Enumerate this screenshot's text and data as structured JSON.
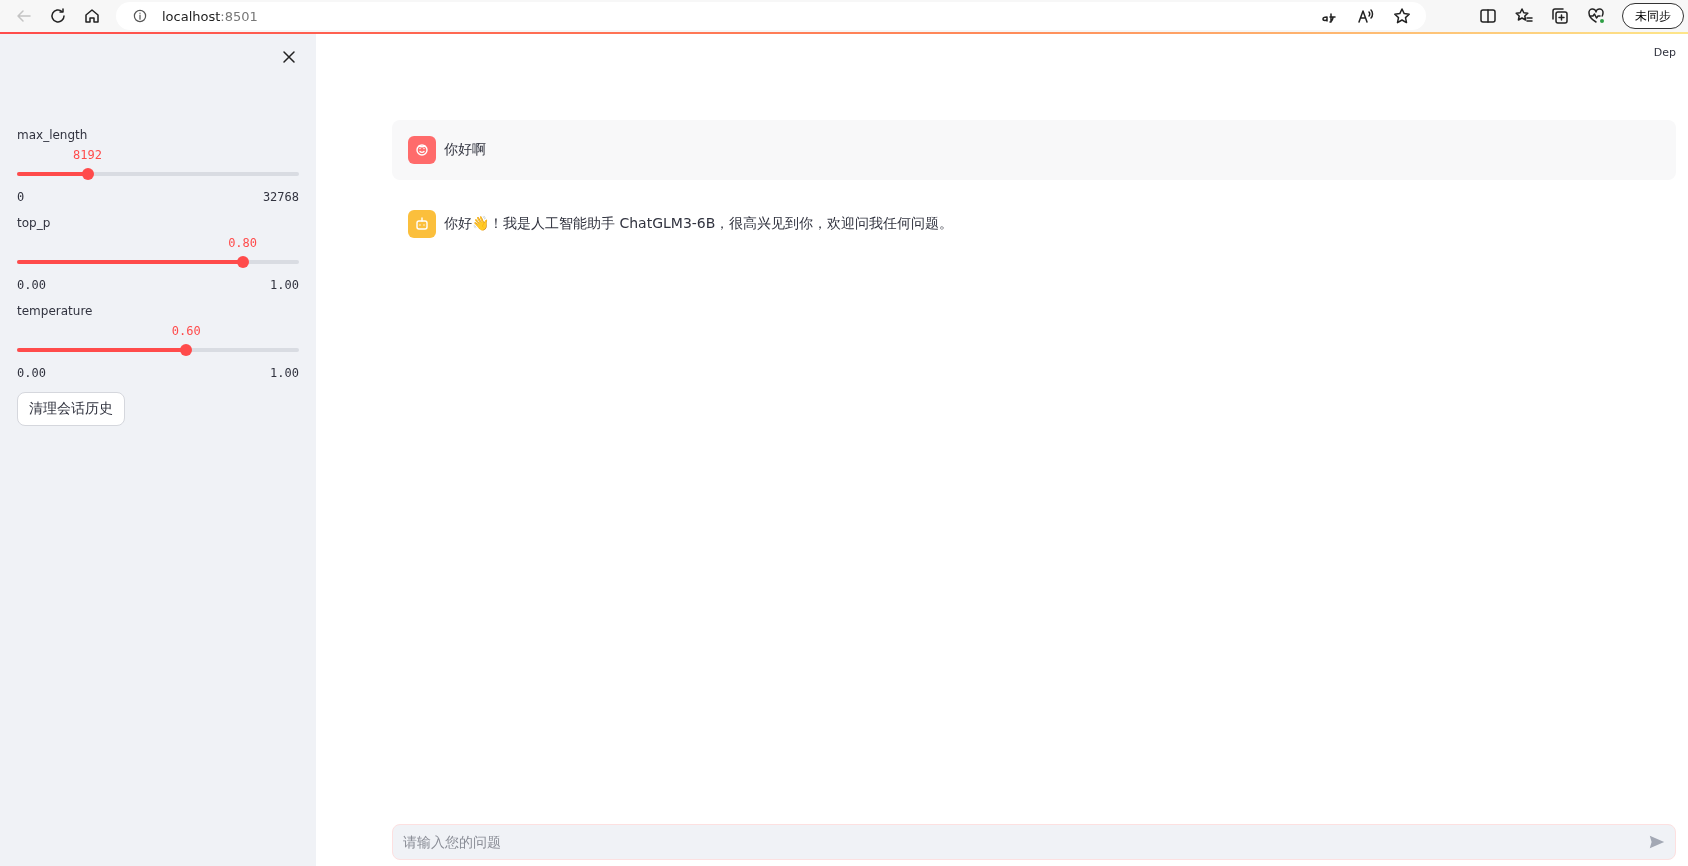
{
  "browser": {
    "back_disabled": true,
    "address_host": "localhost",
    "address_port": ":8501",
    "profile_button": "未同步"
  },
  "header": {
    "deploy_label": "Dep"
  },
  "sidebar": {
    "sliders": [
      {
        "label": "max_length",
        "reading": "8192",
        "level": 0.25,
        "min": "0",
        "max": "32768"
      },
      {
        "label": "top_p",
        "reading": "0.80",
        "level": 0.8,
        "min": "0.00",
        "max": "1.00"
      },
      {
        "label": "temperature",
        "reading": "0.60",
        "level": 0.6,
        "min": "0.00",
        "max": "1.00"
      }
    ],
    "clear_button": "清理会话历史"
  },
  "messages": [
    {
      "kind": "user",
      "text": "你好啊"
    },
    {
      "kind": "assistant",
      "text": "你好👋！我是人工智能助手 ChatGLM3-6B，很高兴见到你，欢迎问我任何问题。"
    }
  ],
  "chat_input": {
    "placeholder": "请输入您的问题"
  }
}
